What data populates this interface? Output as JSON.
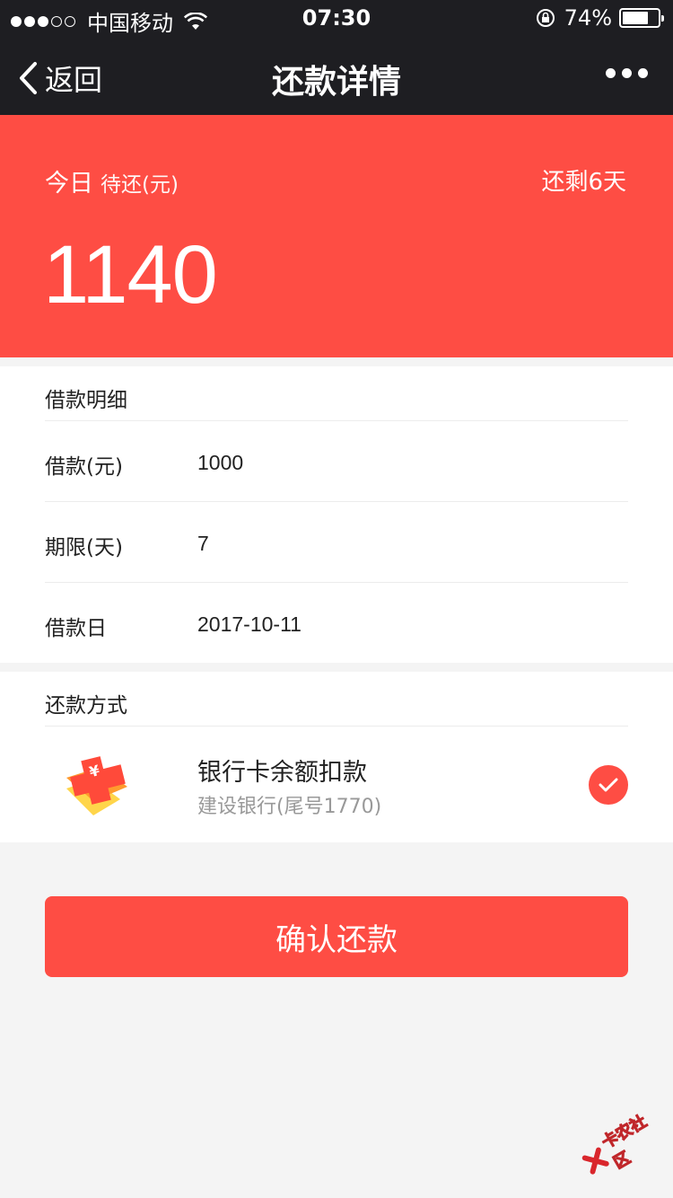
{
  "status_bar": {
    "carrier": "中国移动",
    "time": "07:30",
    "battery": "74%",
    "battery_level": 0.74,
    "signal_icon": "signal-dots-icon",
    "wifi_icon": "wifi-icon",
    "lock_icon": "rotation-lock-icon"
  },
  "nav": {
    "back_label": "返回",
    "title": "还款详情",
    "back_icon": "chevron-left-icon",
    "more_icon": "more-dots-icon"
  },
  "hero": {
    "label": "今日",
    "sub_label": "待还(元)",
    "days_left": "还剩6天",
    "amount": "1140",
    "bg_color": "#fe4d44"
  },
  "loan_details": {
    "title": "借款明细",
    "rows": [
      {
        "label": "借款(元)",
        "value": "1000"
      },
      {
        "label": "期限(天)",
        "value": "7"
      },
      {
        "label": "借款日",
        "value": "2017-10-11"
      }
    ]
  },
  "payment_method": {
    "title": "还款方式",
    "name": "银行卡余额扣款",
    "bank": "建设银行(尾号1770)",
    "icon": "bank-card-icon",
    "selected": true
  },
  "confirm_button": {
    "label": "确认还款",
    "color": "#fe4d44"
  },
  "watermark": {
    "text": "卡农社区"
  }
}
